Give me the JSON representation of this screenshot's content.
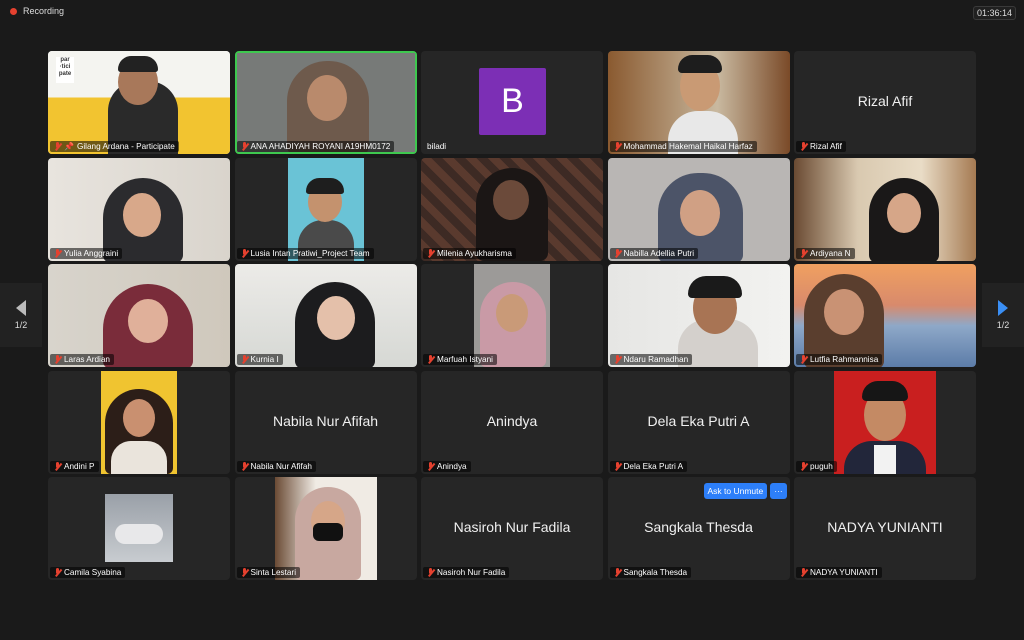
{
  "recording": {
    "label": "Recording"
  },
  "clock": "01:36:14",
  "pager": {
    "left_label": "1/2",
    "right_label": "1/2"
  },
  "logo_text": "par ·tici pate",
  "tiles": [
    {
      "name": "Gilang Ardana - Participate",
      "big": ""
    },
    {
      "name": "ANA AHADIYAH ROYANI A19HM0172",
      "big": ""
    },
    {
      "name": "biladi",
      "big": "",
      "avatar_letter": "B"
    },
    {
      "name": "Mohammad Hakemal Haikal Harfaz",
      "big": ""
    },
    {
      "name": "Rizal Afif",
      "big": "Rizal Afif"
    },
    {
      "name": "Yulia Anggraini",
      "big": ""
    },
    {
      "name": "Lusia Intan Pratiwi_Project Team",
      "big": ""
    },
    {
      "name": "Milenia Ayukharisma",
      "big": ""
    },
    {
      "name": "Nabilla Adellia Putri",
      "big": ""
    },
    {
      "name": "Ardiyana N",
      "big": ""
    },
    {
      "name": "Laras Ardian",
      "big": ""
    },
    {
      "name": "Kurnia I",
      "big": ""
    },
    {
      "name": "Marfuah Istyani",
      "big": ""
    },
    {
      "name": "Ndaru Ramadhan",
      "big": ""
    },
    {
      "name": "Lutfia Rahmannisa",
      "big": ""
    },
    {
      "name": "Andini P",
      "big": ""
    },
    {
      "name": "Nabila Nur Afifah",
      "big": "Nabila Nur Afifah"
    },
    {
      "name": "Anindya",
      "big": "Anindya"
    },
    {
      "name": "Dela Eka Putri A",
      "big": "Dela Eka Putri A"
    },
    {
      "name": "puguh",
      "big": ""
    },
    {
      "name": "Camila Syabina",
      "big": ""
    },
    {
      "name": "Sinta Lestari",
      "big": ""
    },
    {
      "name": "Nasiroh Nur Fadila",
      "big": "Nasiroh Nur Fadila"
    },
    {
      "name": "Sangkala Thesda",
      "big": "Sangkala Thesda"
    },
    {
      "name": "NADYA YUNIANTI",
      "big": "NADYA YUNIANTI"
    }
  ],
  "unmute": {
    "label": "Ask to Unmute",
    "more": "···"
  },
  "colors": {
    "accent_blue": "#2d7ff9",
    "active_speaker": "#3ec84f",
    "muted_red": "#e5412f",
    "avatar_purple": "#7c2fb5"
  }
}
